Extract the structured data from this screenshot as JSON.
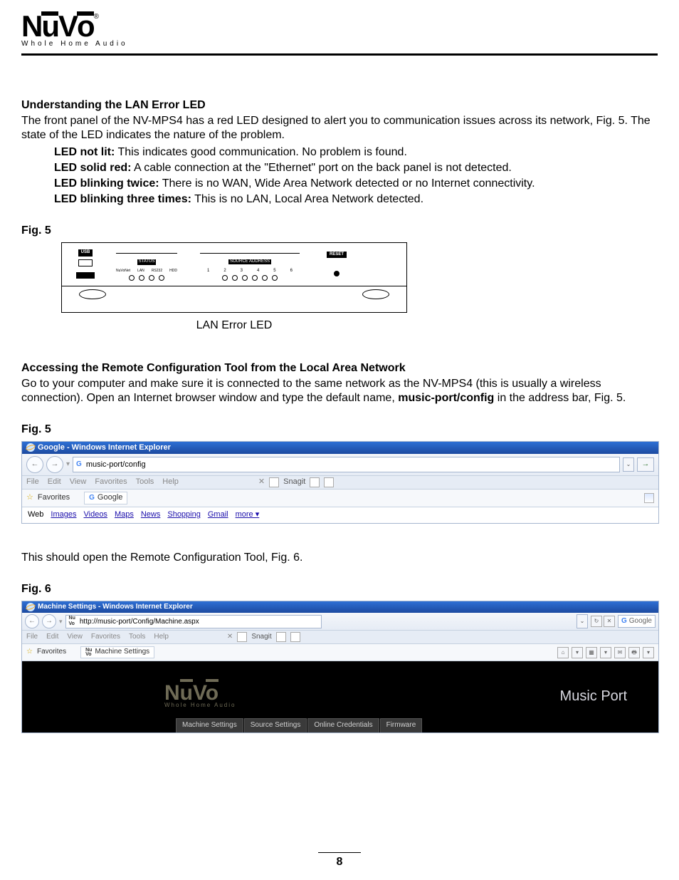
{
  "logo": {
    "brand": "NuVo",
    "tagline": "Whole Home Audio",
    "reg": "®"
  },
  "s1": {
    "title": "Understanding the LAN Error LED",
    "para": "The front panel of the NV-MPS4 has a red LED designed to alert you to communication issues across its network, Fig. 5. The state of the LED indicates the nature of the problem.",
    "b1": {
      "label": "LED not lit:",
      "text": " This indicates good communication. No problem is found."
    },
    "b2": {
      "label": "LED solid red:",
      "text": "  A cable connection at the \"Ethernet\" port on the back panel is not detected."
    },
    "b3": {
      "label": "LED blinking twice:",
      "text": "  There is no WAN, Wide Area Network detected or no Internet connectivity."
    },
    "b4": {
      "label": "LED blinking three times:",
      "text": "  This is no LAN, Local Area Network detected."
    }
  },
  "fig5a": {
    "label": "Fig. 5",
    "usb": "USB",
    "status": "STATUS",
    "statusLabels": {
      "a": "NuVoNet",
      "b": "LAN",
      "c": "RS232",
      "d": "HDD"
    },
    "src": "SOURCE ADDRESS",
    "srcNums": {
      "n1": "1",
      "n2": "2",
      "n3": "3",
      "n4": "4",
      "n5": "5",
      "n6": "6"
    },
    "reset": "RESET",
    "caption": "LAN Error LED"
  },
  "s2": {
    "title": "Accessing the Remote Configuration Tool from the Local Area Network",
    "para1": "Go to your computer and make sure it is connected to the same network as the NV-MPS4 (this is usually a wireless connection).  Open an Internet browser window and type the default name, ",
    "bold": "music-port/config",
    "para2": " in the address bar, Fig. 5."
  },
  "fig5b": {
    "label": "Fig. 5",
    "title": "Google - Windows Internet Explorer",
    "url": "music-port/config",
    "menu": {
      "file": "File",
      "edit": "Edit",
      "view": "View",
      "fav": "Favorites",
      "tools": "Tools",
      "help": "Help"
    },
    "snagit": "Snagit",
    "favorites": "Favorites",
    "tab": "Google",
    "nav": {
      "web": "Web",
      "images": "Images",
      "videos": "Videos",
      "maps": "Maps",
      "news": "News",
      "shopping": "Shopping",
      "gmail": "Gmail",
      "more": "more ▾"
    }
  },
  "s3": {
    "para": "This should open the Remote Configuration Tool, Fig. 6."
  },
  "fig6": {
    "label": "Fig. 6",
    "title": "Machine Settings - Windows Internet Explorer",
    "url": "http://music-port/Config/Machine.aspx",
    "search": "Google",
    "menu": {
      "file": "File",
      "edit": "Edit",
      "view": "View",
      "fav": "Favorites",
      "tools": "Tools",
      "help": "Help"
    },
    "snagit": "Snagit",
    "favorites": "Favorites",
    "tab": "Machine Settings",
    "brand": "NuVo",
    "tagline": "Whole Home Audio",
    "product": "Music Port",
    "tabs": {
      "t1": "Machine Settings",
      "t2": "Source Settings",
      "t3": "Online Credentials",
      "t4": "Firmware"
    }
  },
  "pageNumber": "8"
}
